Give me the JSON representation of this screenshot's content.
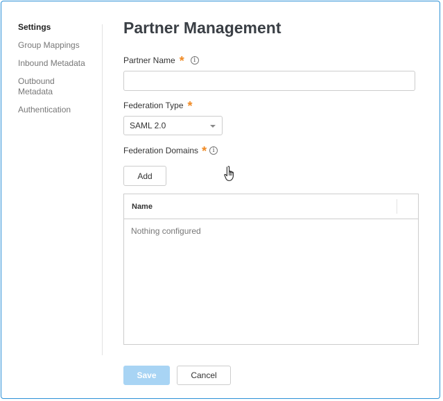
{
  "sidebar": {
    "items": [
      {
        "label": "Settings",
        "active": true
      },
      {
        "label": "Group Mappings"
      },
      {
        "label": "Inbound Metadata"
      },
      {
        "label": "Outbound\nMetadata"
      },
      {
        "label": "Authentication"
      }
    ]
  },
  "header": {
    "title": "Partner Management"
  },
  "form": {
    "partner_name": {
      "label": "Partner Name",
      "required_mark": "*",
      "info_icon": "i",
      "value": "",
      "placeholder": ""
    },
    "federation_type": {
      "label": "Federation Type",
      "required_mark": "*",
      "selected": "SAML 2.0"
    },
    "federation_domains": {
      "label": "Federation Domains",
      "required_mark": "*",
      "info_icon": "i",
      "add_label": "Add"
    }
  },
  "table": {
    "columns": [
      "Name"
    ],
    "empty_text": "Nothing configured"
  },
  "footer": {
    "save_label": "Save",
    "cancel_label": "Cancel"
  },
  "colors": {
    "accent_border": "#2a8fd6",
    "required": "#f08a24",
    "save_disabled": "#a8d4f4"
  },
  "icons": {
    "info": "info-icon",
    "dropdown": "chevron-down-icon",
    "cursor": "hand-pointer-icon"
  }
}
